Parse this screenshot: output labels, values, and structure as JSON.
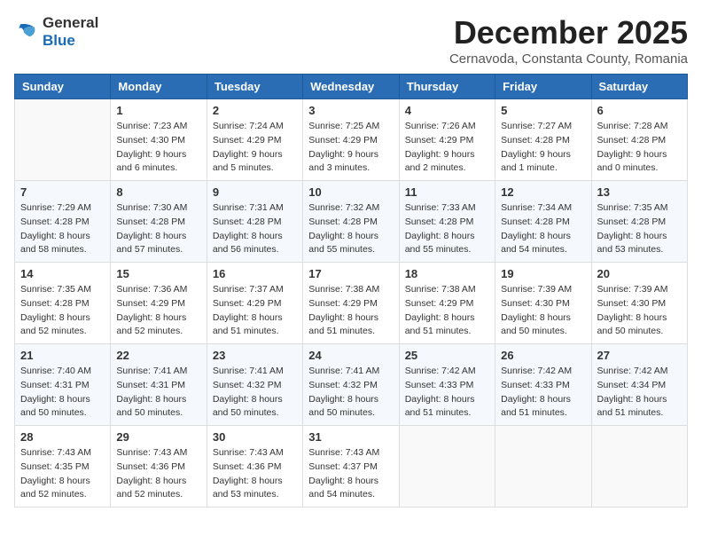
{
  "logo": {
    "general": "General",
    "blue": "Blue"
  },
  "title": "December 2025",
  "location": "Cernavoda, Constanta County, Romania",
  "days_of_week": [
    "Sunday",
    "Monday",
    "Tuesday",
    "Wednesday",
    "Thursday",
    "Friday",
    "Saturday"
  ],
  "weeks": [
    [
      {
        "day": "",
        "sunrise": "",
        "sunset": "",
        "daylight": ""
      },
      {
        "day": "1",
        "sunrise": "Sunrise: 7:23 AM",
        "sunset": "Sunset: 4:30 PM",
        "daylight": "Daylight: 9 hours and 6 minutes."
      },
      {
        "day": "2",
        "sunrise": "Sunrise: 7:24 AM",
        "sunset": "Sunset: 4:29 PM",
        "daylight": "Daylight: 9 hours and 5 minutes."
      },
      {
        "day": "3",
        "sunrise": "Sunrise: 7:25 AM",
        "sunset": "Sunset: 4:29 PM",
        "daylight": "Daylight: 9 hours and 3 minutes."
      },
      {
        "day": "4",
        "sunrise": "Sunrise: 7:26 AM",
        "sunset": "Sunset: 4:29 PM",
        "daylight": "Daylight: 9 hours and 2 minutes."
      },
      {
        "day": "5",
        "sunrise": "Sunrise: 7:27 AM",
        "sunset": "Sunset: 4:28 PM",
        "daylight": "Daylight: 9 hours and 1 minute."
      },
      {
        "day": "6",
        "sunrise": "Sunrise: 7:28 AM",
        "sunset": "Sunset: 4:28 PM",
        "daylight": "Daylight: 9 hours and 0 minutes."
      }
    ],
    [
      {
        "day": "7",
        "sunrise": "Sunrise: 7:29 AM",
        "sunset": "Sunset: 4:28 PM",
        "daylight": "Daylight: 8 hours and 58 minutes."
      },
      {
        "day": "8",
        "sunrise": "Sunrise: 7:30 AM",
        "sunset": "Sunset: 4:28 PM",
        "daylight": "Daylight: 8 hours and 57 minutes."
      },
      {
        "day": "9",
        "sunrise": "Sunrise: 7:31 AM",
        "sunset": "Sunset: 4:28 PM",
        "daylight": "Daylight: 8 hours and 56 minutes."
      },
      {
        "day": "10",
        "sunrise": "Sunrise: 7:32 AM",
        "sunset": "Sunset: 4:28 PM",
        "daylight": "Daylight: 8 hours and 55 minutes."
      },
      {
        "day": "11",
        "sunrise": "Sunrise: 7:33 AM",
        "sunset": "Sunset: 4:28 PM",
        "daylight": "Daylight: 8 hours and 55 minutes."
      },
      {
        "day": "12",
        "sunrise": "Sunrise: 7:34 AM",
        "sunset": "Sunset: 4:28 PM",
        "daylight": "Daylight: 8 hours and 54 minutes."
      },
      {
        "day": "13",
        "sunrise": "Sunrise: 7:35 AM",
        "sunset": "Sunset: 4:28 PM",
        "daylight": "Daylight: 8 hours and 53 minutes."
      }
    ],
    [
      {
        "day": "14",
        "sunrise": "Sunrise: 7:35 AM",
        "sunset": "Sunset: 4:28 PM",
        "daylight": "Daylight: 8 hours and 52 minutes."
      },
      {
        "day": "15",
        "sunrise": "Sunrise: 7:36 AM",
        "sunset": "Sunset: 4:29 PM",
        "daylight": "Daylight: 8 hours and 52 minutes."
      },
      {
        "day": "16",
        "sunrise": "Sunrise: 7:37 AM",
        "sunset": "Sunset: 4:29 PM",
        "daylight": "Daylight: 8 hours and 51 minutes."
      },
      {
        "day": "17",
        "sunrise": "Sunrise: 7:38 AM",
        "sunset": "Sunset: 4:29 PM",
        "daylight": "Daylight: 8 hours and 51 minutes."
      },
      {
        "day": "18",
        "sunrise": "Sunrise: 7:38 AM",
        "sunset": "Sunset: 4:29 PM",
        "daylight": "Daylight: 8 hours and 51 minutes."
      },
      {
        "day": "19",
        "sunrise": "Sunrise: 7:39 AM",
        "sunset": "Sunset: 4:30 PM",
        "daylight": "Daylight: 8 hours and 50 minutes."
      },
      {
        "day": "20",
        "sunrise": "Sunrise: 7:39 AM",
        "sunset": "Sunset: 4:30 PM",
        "daylight": "Daylight: 8 hours and 50 minutes."
      }
    ],
    [
      {
        "day": "21",
        "sunrise": "Sunrise: 7:40 AM",
        "sunset": "Sunset: 4:31 PM",
        "daylight": "Daylight: 8 hours and 50 minutes."
      },
      {
        "day": "22",
        "sunrise": "Sunrise: 7:41 AM",
        "sunset": "Sunset: 4:31 PM",
        "daylight": "Daylight: 8 hours and 50 minutes."
      },
      {
        "day": "23",
        "sunrise": "Sunrise: 7:41 AM",
        "sunset": "Sunset: 4:32 PM",
        "daylight": "Daylight: 8 hours and 50 minutes."
      },
      {
        "day": "24",
        "sunrise": "Sunrise: 7:41 AM",
        "sunset": "Sunset: 4:32 PM",
        "daylight": "Daylight: 8 hours and 50 minutes."
      },
      {
        "day": "25",
        "sunrise": "Sunrise: 7:42 AM",
        "sunset": "Sunset: 4:33 PM",
        "daylight": "Daylight: 8 hours and 51 minutes."
      },
      {
        "day": "26",
        "sunrise": "Sunrise: 7:42 AM",
        "sunset": "Sunset: 4:33 PM",
        "daylight": "Daylight: 8 hours and 51 minutes."
      },
      {
        "day": "27",
        "sunrise": "Sunrise: 7:42 AM",
        "sunset": "Sunset: 4:34 PM",
        "daylight": "Daylight: 8 hours and 51 minutes."
      }
    ],
    [
      {
        "day": "28",
        "sunrise": "Sunrise: 7:43 AM",
        "sunset": "Sunset: 4:35 PM",
        "daylight": "Daylight: 8 hours and 52 minutes."
      },
      {
        "day": "29",
        "sunrise": "Sunrise: 7:43 AM",
        "sunset": "Sunset: 4:36 PM",
        "daylight": "Daylight: 8 hours and 52 minutes."
      },
      {
        "day": "30",
        "sunrise": "Sunrise: 7:43 AM",
        "sunset": "Sunset: 4:36 PM",
        "daylight": "Daylight: 8 hours and 53 minutes."
      },
      {
        "day": "31",
        "sunrise": "Sunrise: 7:43 AM",
        "sunset": "Sunset: 4:37 PM",
        "daylight": "Daylight: 8 hours and 54 minutes."
      },
      {
        "day": "",
        "sunrise": "",
        "sunset": "",
        "daylight": ""
      },
      {
        "day": "",
        "sunrise": "",
        "sunset": "",
        "daylight": ""
      },
      {
        "day": "",
        "sunrise": "",
        "sunset": "",
        "daylight": ""
      }
    ]
  ]
}
